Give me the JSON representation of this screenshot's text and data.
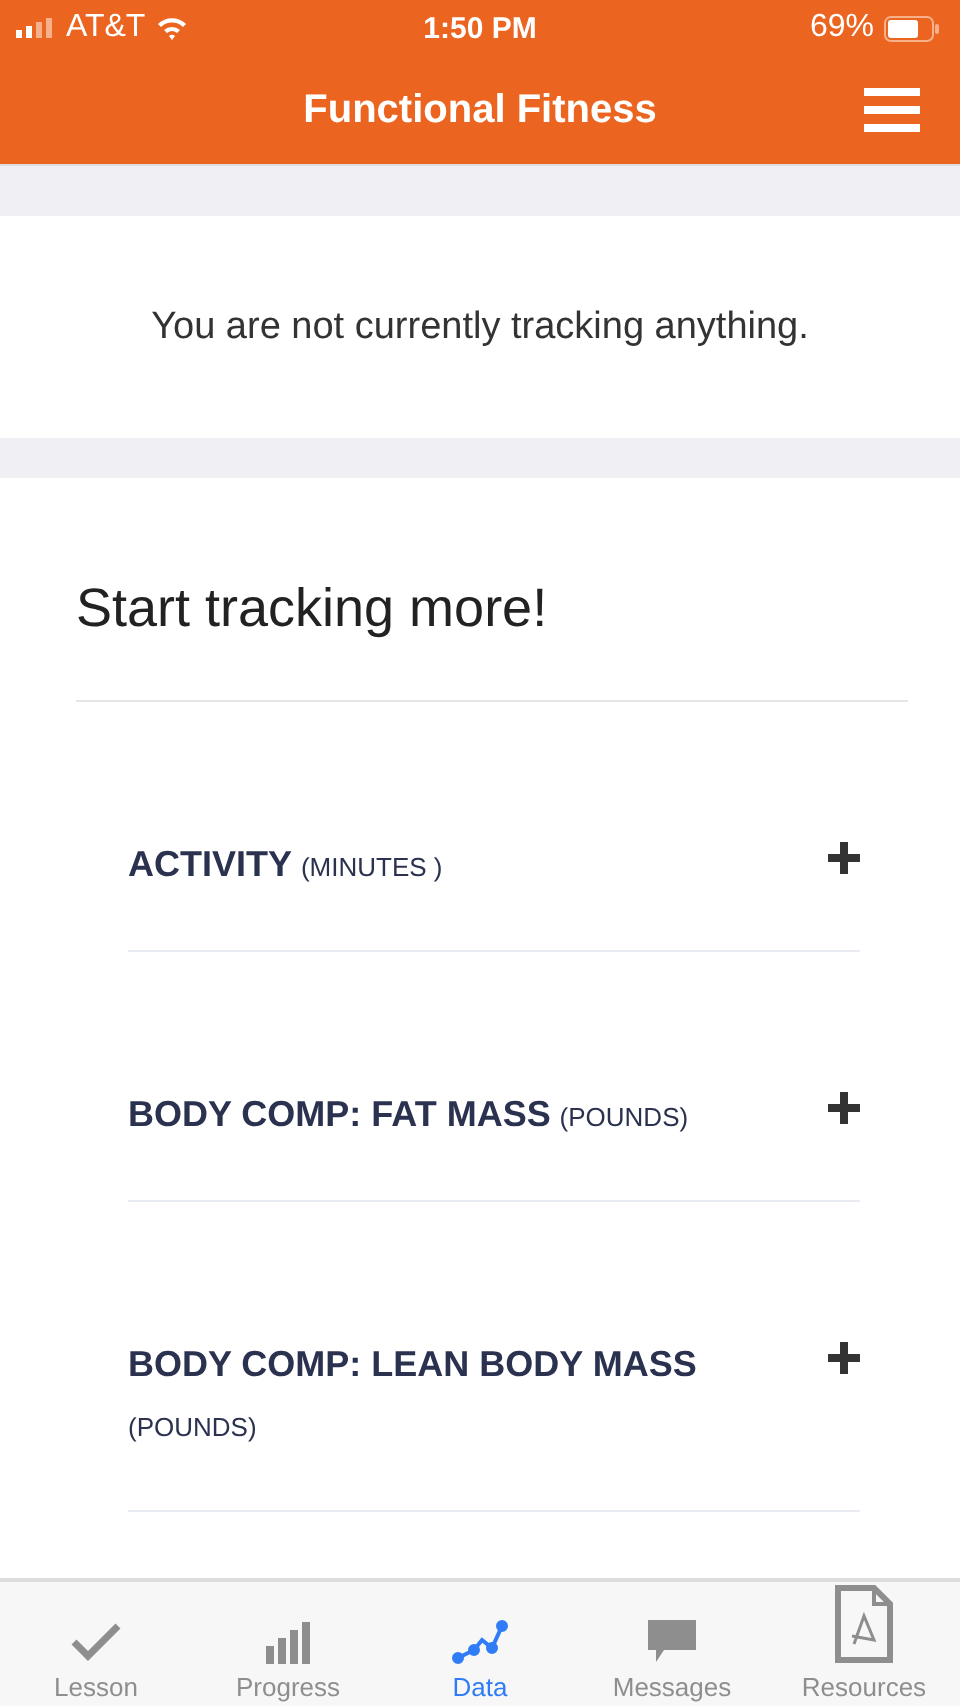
{
  "status_bar": {
    "carrier": "AT&T",
    "time": "1:50 PM",
    "battery": "69%"
  },
  "header": {
    "title": "Functional Fitness"
  },
  "notice": "You are not currently tracking anything.",
  "section": {
    "title": "Start tracking more!"
  },
  "trackers": [
    {
      "name": "ACTIVITY",
      "unit": "(MINUTES )"
    },
    {
      "name": "BODY COMP: FAT MASS",
      "unit": "(POUNDS)"
    },
    {
      "name": "BODY COMP: LEAN BODY MASS",
      "unit": "(POUNDS)"
    }
  ],
  "tabs": [
    {
      "label": "Lesson",
      "kind": "check",
      "selected": false
    },
    {
      "label": "Progress",
      "kind": "bars",
      "selected": false
    },
    {
      "label": "Data",
      "kind": "line",
      "selected": true
    },
    {
      "label": "Messages",
      "kind": "bubble",
      "selected": false
    },
    {
      "label": "Resources",
      "kind": "pdf",
      "selected": false
    }
  ]
}
